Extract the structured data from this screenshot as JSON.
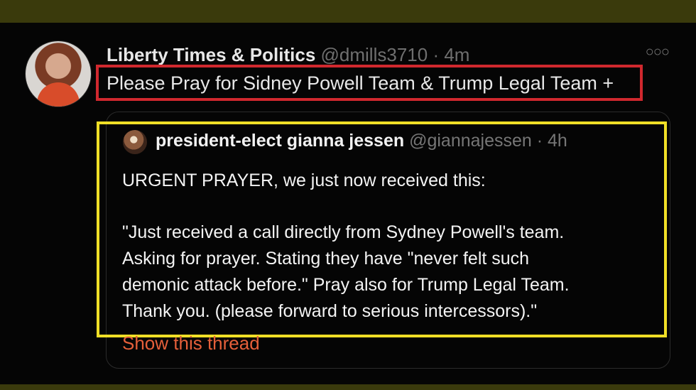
{
  "tweet": {
    "account_name": "Liberty Times & Politics",
    "handle": "@dmills3710",
    "time": "4m",
    "more_icon": "more-horizontal-icon",
    "text": "Please Pray for Sidney Powell Team & Trump Legal Team +"
  },
  "quote": {
    "account_name": "president-elect gianna jessen",
    "handle": "@giannajessen",
    "time": "4h",
    "lines": [
      "URGENT PRAYER,  we just now received this:",
      " \"Just received a call directly from Sydney Powell's team.",
      "Asking for prayer. Stating they have \"never felt such",
      "demonic attack before.\" Pray also for Trump Legal Team.",
      "Thank you. (please forward to serious intercessors).\""
    ],
    "thread_link": "Show this thread"
  },
  "highlight_colors": {
    "tweet_text": "#d0282e",
    "quote": "#f0df26"
  }
}
